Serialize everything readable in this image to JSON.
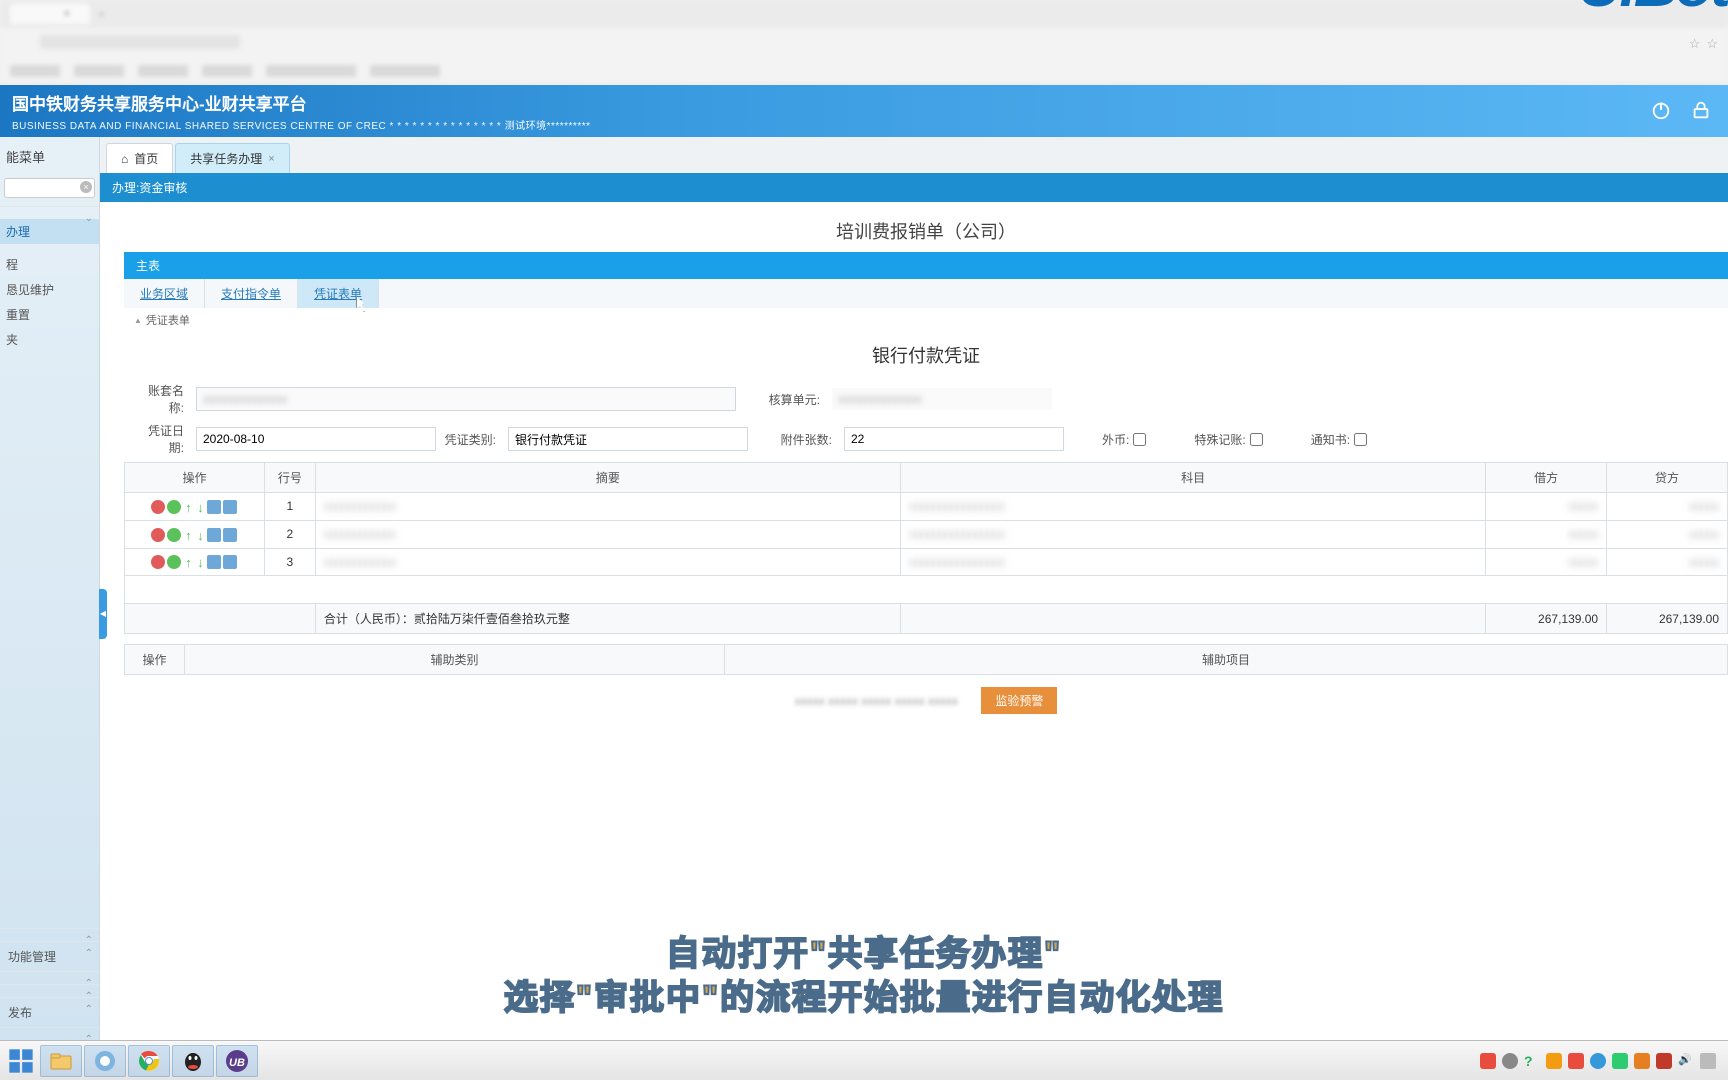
{
  "app": {
    "title": "国中铁财务共享服务中心-业财共享平台",
    "subtitle": "BUSINESS DATA AND FINANCIAL SHARED SERVICES CENTRE OF CREC * * * * * * * * * * * * * * * 测试环境**********",
    "logo": "UiBot"
  },
  "sidebar": {
    "title": "能菜单",
    "search_placeholder": "",
    "items": [
      {
        "label": "办理",
        "active": true
      },
      {
        "label": ""
      },
      {
        "label": "程"
      },
      {
        "label": "恳见维护"
      },
      {
        "label": "重置"
      },
      {
        "label": "夹"
      }
    ],
    "bottom_sections": [
      {
        "label": "功能管理"
      },
      {
        "label": "发布"
      }
    ]
  },
  "tabs": {
    "home": "首页",
    "active": "共享任务办理"
  },
  "breadcrumb": "办理:资金审核",
  "doc": {
    "title": "培训费报销单（公司）",
    "panel": "主表",
    "inner_tabs": [
      "业务区域",
      "支付指令单",
      "凭证表单"
    ],
    "section_label": "凭证表单",
    "voucher_title": "银行付款凭证"
  },
  "form": {
    "acct_label": "账套名称:",
    "acct_value": "",
    "unit_label": "核算单元:",
    "unit_value": "",
    "date_label": "凭证日期:",
    "date_value": "2020-08-10",
    "type_label": "凭证类别:",
    "type_value": "银行付款凭证",
    "attach_label": "附件张数:",
    "attach_value": "22",
    "foreign_label": "外币:",
    "special_label": "特殊记账:",
    "notice_label": "通知书:"
  },
  "table": {
    "headers": {
      "op": "操作",
      "row": "行号",
      "summary": "摘要",
      "subject": "科目",
      "debit": "借方",
      "credit": "贷方"
    },
    "rows": [
      {
        "no": "1",
        "summary": "",
        "subject": "",
        "debit": "",
        "credit": ""
      },
      {
        "no": "2",
        "summary": "",
        "subject": "",
        "debit": "",
        "credit": ""
      },
      {
        "no": "3",
        "summary": "",
        "subject": "",
        "debit": "",
        "credit": ""
      }
    ],
    "total_label": "合计（人民币）：贰拾陆万柒仟壹佰叁拾玖元整",
    "total_debit": "267,139.00",
    "total_credit": "267,139.00"
  },
  "aux": {
    "op": "操作",
    "cat": "辅助类别",
    "proj": "辅助项目"
  },
  "bottom": {
    "warn_btn": "监验预警"
  },
  "subtitle": {
    "line1": "自动打开\"共享任务办理\"",
    "line2": "选择\"审批中\"的流程开始批量进行自动化处理"
  },
  "taskbar": {
    "time": ""
  }
}
